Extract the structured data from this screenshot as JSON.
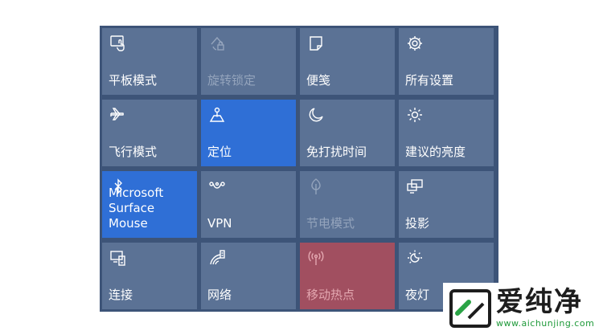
{
  "tiles": [
    {
      "label": "平板模式",
      "icon": "tablet-mode-icon",
      "state": "normal"
    },
    {
      "label": "旋转锁定",
      "icon": "rotation-lock-icon",
      "state": "disabled"
    },
    {
      "label": "便笺",
      "icon": "note-icon",
      "state": "normal"
    },
    {
      "label": "所有设置",
      "icon": "gear-icon",
      "state": "normal"
    },
    {
      "label": "飞行模式",
      "icon": "airplane-icon",
      "state": "normal"
    },
    {
      "label": "定位",
      "icon": "location-icon",
      "state": "active"
    },
    {
      "label": "免打扰时间",
      "icon": "moon-icon",
      "state": "normal"
    },
    {
      "label": "建议的亮度",
      "icon": "brightness-icon",
      "state": "normal"
    },
    {
      "label": "Microsoft\nSurface Mouse",
      "icon": "bluetooth-icon",
      "state": "active"
    },
    {
      "label": "VPN",
      "icon": "vpn-icon",
      "state": "normal"
    },
    {
      "label": "节电模式",
      "icon": "battery-saver-leaf-icon",
      "state": "disabled"
    },
    {
      "label": "投影",
      "icon": "project-icon",
      "state": "normal"
    },
    {
      "label": "连接",
      "icon": "connect-icon",
      "state": "normal"
    },
    {
      "label": "网络",
      "icon": "network-icon",
      "state": "normal"
    },
    {
      "label": "移动热点",
      "icon": "mobile-hotspot-icon",
      "state": "hotspot"
    },
    {
      "label": "夜灯",
      "icon": "night-light-icon",
      "state": "normal"
    }
  ],
  "watermark": {
    "name": "爱纯净",
    "url": "www.aichunjing.com"
  },
  "colors": {
    "tile": "#5b7295",
    "active": "#2f6fd6",
    "hotspot": "#a14f60",
    "panel": "#3d5478"
  }
}
